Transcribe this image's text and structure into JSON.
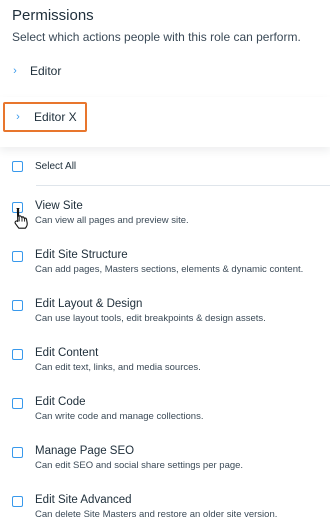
{
  "header": {
    "title": "Permissions",
    "subtitle": "Select which actions people with this role can perform."
  },
  "sections": [
    {
      "label": "Editor",
      "chevron": "›"
    },
    {
      "label": "Editor X",
      "chevron": "›"
    }
  ],
  "select_all": {
    "label": "Select All",
    "checked": false
  },
  "permissions": [
    {
      "title": "View Site",
      "desc": "Can view all pages and preview site.",
      "checked": false
    },
    {
      "title": "Edit Site Structure",
      "desc": "Can add pages, Masters sections, elements & dynamic content.",
      "checked": false
    },
    {
      "title": "Edit Layout & Design",
      "desc": "Can use layout tools, edit breakpoints & design assets.",
      "checked": false
    },
    {
      "title": "Edit Content",
      "desc": "Can edit text, links, and media sources.",
      "checked": false
    },
    {
      "title": "Edit Code",
      "desc": "Can write code and manage collections.",
      "checked": false
    },
    {
      "title": "Manage Page SEO",
      "desc": "Can edit SEO and social share settings per page.",
      "checked": false
    },
    {
      "title": "Edit Site Advanced",
      "desc": "Can delete Site Masters and restore an older site version.",
      "checked": false
    }
  ],
  "icons": {
    "chevron": "chevron-right-icon",
    "checkbox": "checkbox-icon",
    "cursor": "hand-pointer-icon"
  },
  "colors": {
    "accent": "#3899ec",
    "highlight": "#e8762d",
    "text": "#20303c"
  }
}
